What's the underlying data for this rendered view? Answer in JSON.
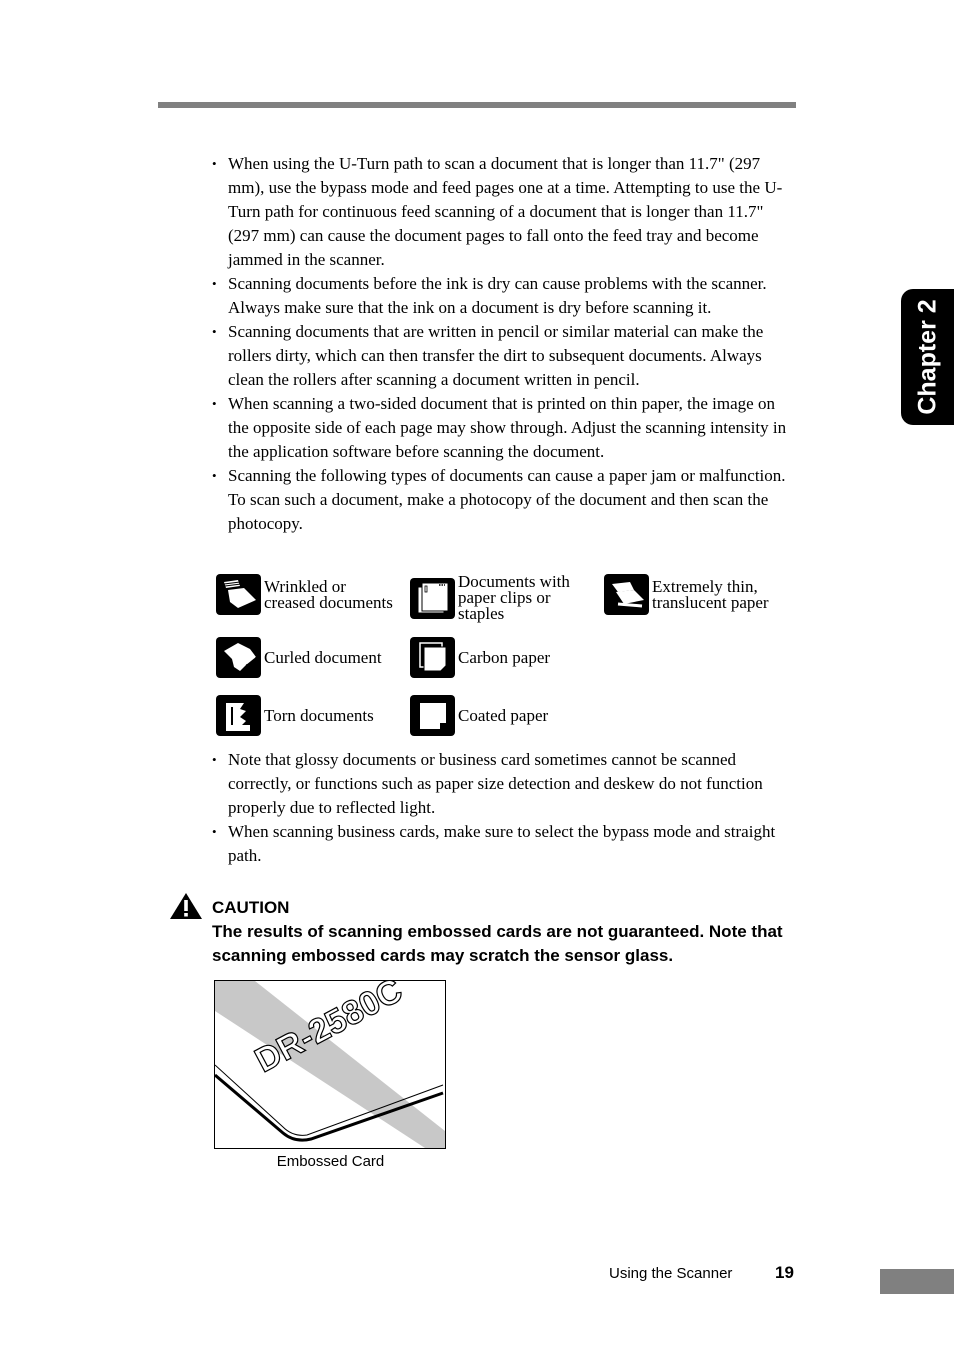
{
  "chapter_tab": "Chapter 2",
  "bullets_top": [
    "When using the U-Turn path to scan a document that is longer than 11.7\" (297 mm), use the bypass mode and feed pages one at a time. Attempting to use the U-Turn path for continuous feed scanning of a document that is longer than 11.7\" (297 mm) can cause the document pages to fall onto the feed tray and become jammed in the scanner.",
    "Scanning documents before the ink is dry can cause problems with the scanner. Always make sure that the ink on a document is dry before scanning it.",
    "Scanning documents that are written in pencil or similar material can make the rollers dirty, which can then transfer the dirt to subsequent documents. Always clean the rollers after scanning a document written in pencil.",
    "When scanning a two-sided document that is printed on thin paper, the image on the opposite side of each page may show through. Adjust the scanning intensity in the application software before scanning the document.",
    "Scanning the following types of documents can cause a paper jam or malfunction. To scan such a document, make a photocopy of the document and then scan the photocopy."
  ],
  "document_types": [
    {
      "icon": "wrinkled-document-icon",
      "label": "Wrinkled or\ncreased documents"
    },
    {
      "icon": "paper-clip-document-icon",
      "label": "Documents with\npaper clips or\nstaples"
    },
    {
      "icon": "thin-paper-icon",
      "label": "Extremely thin,\ntranslucent paper"
    },
    {
      "icon": "curled-document-icon",
      "label": "Curled document"
    },
    {
      "icon": "carbon-paper-icon",
      "label": "Carbon paper"
    },
    {
      "icon": "torn-document-icon",
      "label": "Torn documents"
    },
    {
      "icon": "coated-paper-icon",
      "label": "Coated paper"
    }
  ],
  "bullets_bottom": [
    "Note that glossy documents or business card sometimes cannot be scanned correctly, or functions such as paper size detection and deskew do not function properly due to reflected light.",
    "When scanning business cards, make sure to select the bypass mode and straight path."
  ],
  "caution": {
    "title": "CAUTION",
    "text": "The results of scanning embossed cards are not guaranteed. Note that scanning embossed cards may scratch the sensor glass."
  },
  "figure": {
    "embossed_text": "DR-2580C",
    "caption": "Embossed Card"
  },
  "footer": {
    "section": "Using the Scanner",
    "page_number": "19"
  }
}
